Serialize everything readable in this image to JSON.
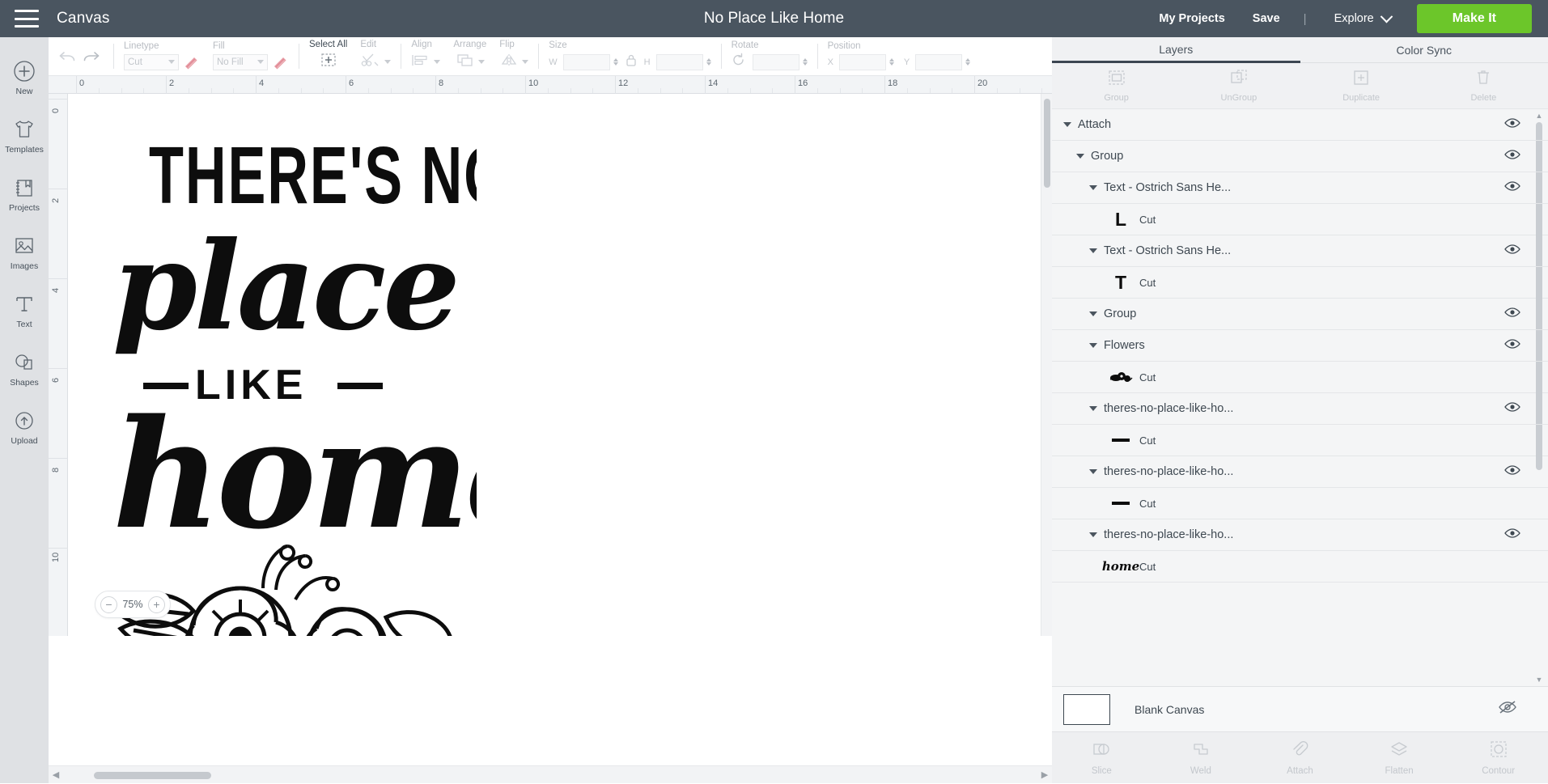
{
  "header": {
    "menu_icon": "hamburger-icon",
    "canvas_label": "Canvas",
    "project_title": "No Place Like Home",
    "my_projects": "My Projects",
    "save": "Save",
    "separator": "|",
    "explore": "Explore",
    "make_it": "Make It",
    "bg_color": "#4a5560",
    "make_it_color": "#6cc62a"
  },
  "rail": {
    "items": [
      {
        "label": "New",
        "icon": "plus-circle-icon"
      },
      {
        "label": "Templates",
        "icon": "tshirt-icon"
      },
      {
        "label": "Projects",
        "icon": "book-bookmark-icon"
      },
      {
        "label": "Images",
        "icon": "image-icon"
      },
      {
        "label": "Text",
        "icon": "text-t-icon"
      },
      {
        "label": "Shapes",
        "icon": "shapes-icon"
      },
      {
        "label": "Upload",
        "icon": "cloud-upload-icon"
      }
    ]
  },
  "toolbar": {
    "undo": "undo-icon",
    "redo": "redo-icon",
    "linetype": {
      "caption": "Linetype",
      "value": "Cut"
    },
    "fill": {
      "caption": "Fill",
      "value": "No Fill"
    },
    "select_all": {
      "caption": "Select All",
      "icon": "select-all-icon"
    },
    "edit": {
      "caption": "Edit",
      "icon": "edit-scissors-icon"
    },
    "align": {
      "caption": "Align",
      "icon": "align-icon"
    },
    "arrange": {
      "caption": "Arrange",
      "icon": "arrange-icon"
    },
    "flip": {
      "caption": "Flip",
      "icon": "flip-icon"
    },
    "size": {
      "caption": "Size",
      "w_label": "W",
      "h_label": "H",
      "w_value": "",
      "h_value": "",
      "lock_icon": "lock-icon"
    },
    "rotate": {
      "caption": "Rotate",
      "value": "",
      "icon": "rotate-icon"
    },
    "position": {
      "caption": "Position",
      "x_label": "X",
      "y_label": "Y",
      "x_value": "",
      "y_value": ""
    }
  },
  "canvas": {
    "zoom_value": "75%",
    "zoom_out": "−",
    "zoom_in": "+",
    "ruler_h_labels": [
      "0",
      "2",
      "4",
      "6",
      "8",
      "10",
      "12",
      "14",
      "16",
      "18",
      "20"
    ],
    "ruler_v_labels": [
      "0",
      "2",
      "4",
      "6",
      "8",
      "10"
    ],
    "artwork_lines": [
      "THERE'S NO",
      "place",
      "—LIKE—",
      "home"
    ],
    "artwork_decoration": "flowers"
  },
  "right_panel": {
    "tabs": [
      {
        "label": "Layers",
        "active": true
      },
      {
        "label": "Color Sync",
        "active": false
      }
    ],
    "actions": [
      {
        "label": "Group",
        "icon": "group-icon"
      },
      {
        "label": "UnGroup",
        "icon": "ungroup-icon"
      },
      {
        "label": "Duplicate",
        "icon": "duplicate-icon"
      },
      {
        "label": "Delete",
        "icon": "trash-icon"
      }
    ],
    "layers": [
      {
        "type": "group",
        "name": "Attach",
        "indent": 0,
        "visible": true
      },
      {
        "type": "group",
        "name": "Group",
        "indent": 1,
        "visible": true
      },
      {
        "type": "group",
        "name": "Text - Ostrich Sans He...",
        "indent": 2,
        "visible": true
      },
      {
        "type": "child",
        "glyph": "L",
        "cut": "Cut",
        "indent": 3
      },
      {
        "type": "group",
        "name": "Text - Ostrich Sans He...",
        "indent": 2,
        "visible": true
      },
      {
        "type": "child",
        "glyph": "T",
        "cut": "Cut",
        "indent": 3
      },
      {
        "type": "group",
        "name": "Group",
        "indent": 2,
        "visible": true
      },
      {
        "type": "group",
        "name": "Flowers",
        "indent": 2,
        "visible": true
      },
      {
        "type": "child",
        "glyph": "flower-thumb",
        "cut": "Cut",
        "indent": 3
      },
      {
        "type": "group",
        "name": "theres-no-place-like-ho...",
        "indent": 2,
        "visible": true
      },
      {
        "type": "child",
        "glyph": "—",
        "cut": "Cut",
        "indent": 3
      },
      {
        "type": "group",
        "name": "theres-no-place-like-ho...",
        "indent": 2,
        "visible": true
      },
      {
        "type": "child",
        "glyph": "—",
        "cut": "Cut",
        "indent": 3
      },
      {
        "type": "group",
        "name": "theres-no-place-like-ho...",
        "indent": 2,
        "visible": true
      },
      {
        "type": "child",
        "glyph": "home",
        "cut": "Cut",
        "indent": 3
      }
    ],
    "blank_canvas": {
      "label": "Blank Canvas",
      "icon": "eye-off-icon"
    },
    "bottom_tools": [
      {
        "label": "Slice",
        "icon": "slice-icon"
      },
      {
        "label": "Weld",
        "icon": "weld-icon"
      },
      {
        "label": "Attach",
        "icon": "paperclip-icon"
      },
      {
        "label": "Flatten",
        "icon": "flatten-icon"
      },
      {
        "label": "Contour",
        "icon": "contour-icon"
      }
    ]
  }
}
